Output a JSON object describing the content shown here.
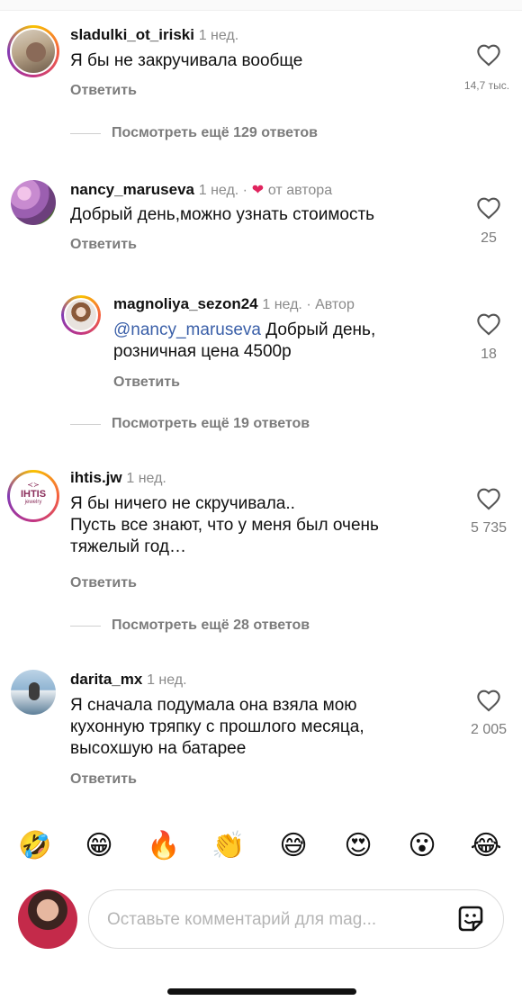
{
  "comments": [
    {
      "username": "sladulki_ot_iriski",
      "meta": "1 нед.",
      "text": "Я бы не закручивала вообще",
      "reply_label": "Ответить",
      "likes": "14,7 тыс.",
      "more_replies": "Посмотреть ещё 129 ответов"
    },
    {
      "username": "nancy_maruseva",
      "meta": "1 нед. ·",
      "author_badge": "от автора",
      "text": "Добрый день,можно узнать стоимость",
      "reply_label": "Ответить",
      "likes": "25"
    },
    {
      "username": "magnoliya_sezon24",
      "meta": "1 нед. · Автор",
      "mention": "@nancy_maruseva",
      "text_line1": " Добрый день,",
      "text_line2": "розничная цена 4500р",
      "reply_label": "Ответить",
      "likes": "18",
      "more_replies": "Посмотреть ещё 19 ответов"
    },
    {
      "username": "ihtis.jw",
      "meta": "1 нед.",
      "avatar_text": "IHTIS",
      "avatar_subtext": "jewelry",
      "text_line1": "Я бы ничего не скручивала..",
      "text_line2": "Пусть все знают, что у меня был очень",
      "text_line3": "тяжелый год…",
      "reply_label": "Ответить",
      "likes": "5 735",
      "more_replies": "Посмотреть ещё 28 ответов"
    },
    {
      "username": "darita_mx",
      "meta": "1 нед.",
      "text_line1": "Я сначала подумала она взяла мою",
      "text_line2": "кухонную тряпку с прошлого месяца,",
      "text_line3": "высохшую на батарее",
      "reply_label": "Ответить",
      "likes": "2 005"
    }
  ],
  "emoji_bar": [
    "🤣",
    "😁",
    "🔥",
    "👏",
    "😅",
    "😍",
    "😮",
    "😂"
  ],
  "composer": {
    "placeholder": "Оставьте комментарий для mag..."
  },
  "colors": {
    "text": "#111111",
    "secondary": "#7c7c7c",
    "mention": "#3a5fa8",
    "heart_red": "#e0245e"
  },
  "icons": {
    "like": "heart-outline-icon",
    "author_like": "heart-filled-icon",
    "sticker": "sticker-icon"
  }
}
